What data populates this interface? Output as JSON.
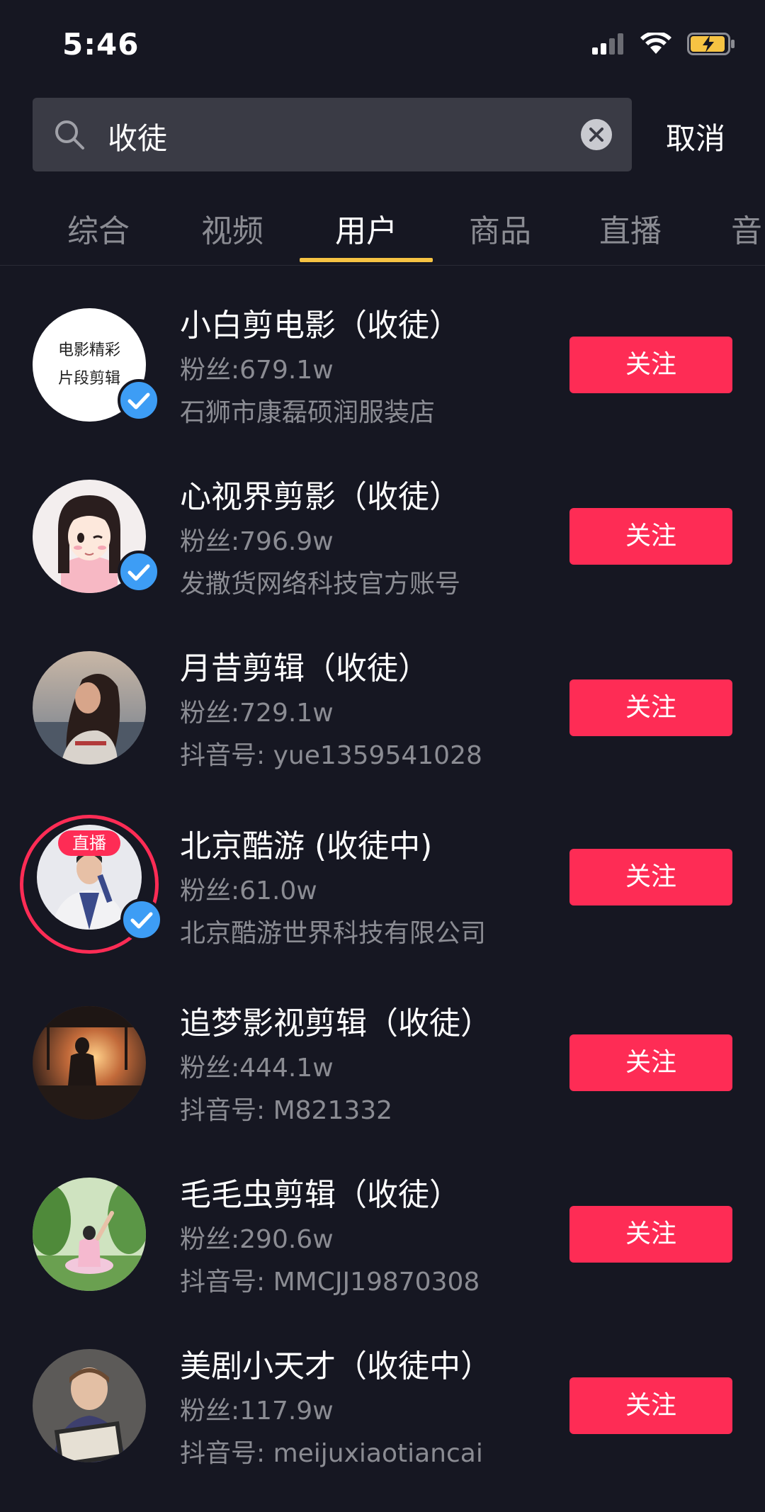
{
  "status_bar": {
    "time": "5:46"
  },
  "search": {
    "query": "收徒",
    "cancel_label": "取消"
  },
  "tabs": [
    {
      "label": "综合"
    },
    {
      "label": "视频"
    },
    {
      "label": "用户"
    },
    {
      "label": "商品"
    },
    {
      "label": "直播"
    },
    {
      "label": "音"
    }
  ],
  "active_tab": "用户",
  "colors": {
    "background": "#161722",
    "accent_follow": "#fe2c55",
    "tab_indicator": "#f6c343",
    "verified": "#3d9df5"
  },
  "users": [
    {
      "name": "小白剪电影（收徒）",
      "fans": "粉丝:679.1w",
      "desc": "石狮市康磊硕润服装店",
      "verified": true,
      "follow_label": "关注",
      "avatar_text_1": "电影精彩",
      "avatar_text_2": "片段剪辑"
    },
    {
      "name": "心视界剪影（收徒）",
      "fans": "粉丝:796.9w",
      "desc": "发撒货网络科技官方账号",
      "verified": true,
      "follow_label": "关注"
    },
    {
      "name": "月昔剪辑（收徒）",
      "fans": "粉丝:729.1w",
      "desc": "抖音号: yue1359541028",
      "verified": false,
      "follow_label": "关注"
    },
    {
      "name": "北京酷游 (收徒中)",
      "fans": "粉丝:61.0w",
      "desc": "北京酷游世界科技有限公司",
      "verified": true,
      "live": true,
      "live_label": "直播",
      "follow_label": "关注"
    },
    {
      "name": "追梦影视剪辑（收徒）",
      "fans": "粉丝:444.1w",
      "desc": "抖音号: M821332",
      "verified": false,
      "follow_label": "关注"
    },
    {
      "name": "毛毛虫剪辑（收徒）",
      "fans": "粉丝:290.6w",
      "desc": "抖音号: MMCJJ19870308",
      "verified": false,
      "follow_label": "关注"
    },
    {
      "name": "美剧小天才（收徒中）",
      "fans": "粉丝:117.9w",
      "desc": "抖音号: meijuxiaotiancai",
      "verified": false,
      "follow_label": "关注"
    }
  ]
}
